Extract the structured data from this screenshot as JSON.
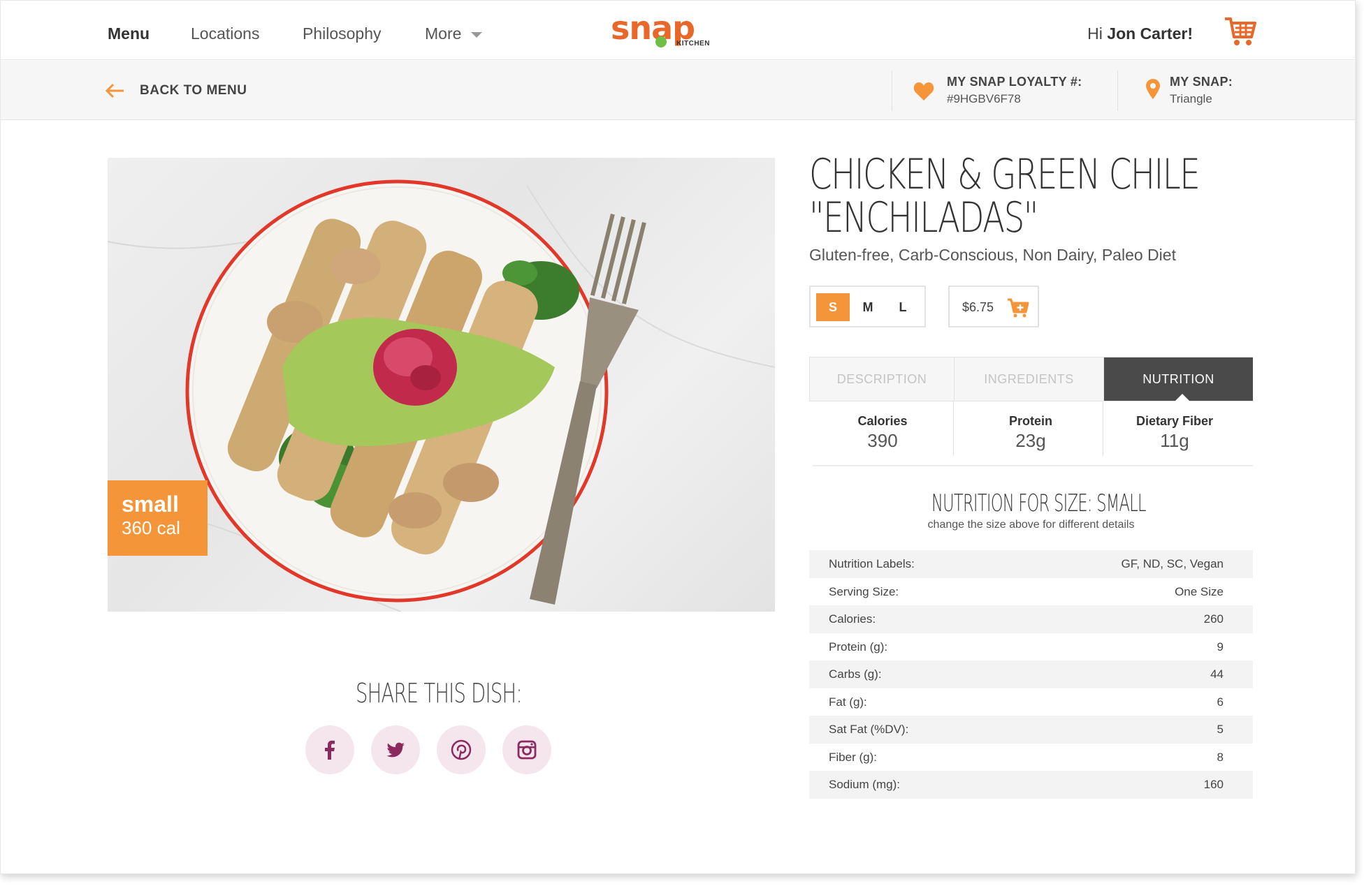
{
  "nav": {
    "links": [
      "Menu",
      "Locations",
      "Philosophy",
      "More"
    ],
    "logo_text": "snap",
    "logo_sub": "KITCHEN",
    "greeting_prefix": "Hi",
    "greeting_name": "Jon Carter!"
  },
  "subbar": {
    "back_label": "BACK TO MENU",
    "loyalty_label": "MY SNAP LOYALTY #:",
    "loyalty_value": "#9HGBV6F78",
    "snap_label": "MY SNAP:",
    "snap_value": "Triangle"
  },
  "hero": {
    "badge_size": "small",
    "badge_cal": "360 cal"
  },
  "share": {
    "title": "SHARE THIS DISH:",
    "networks": [
      "facebook-icon",
      "twitter-icon",
      "pinterest-icon",
      "instagram-icon"
    ]
  },
  "dish": {
    "title_line1": "CHICKEN & GREEN CHILE",
    "title_line2": "\"ENCHILADAS\"",
    "diets": "Gluten-free, Carb-Conscious, Non Dairy, Paleo Diet",
    "sizes": [
      "S",
      "M",
      "L"
    ],
    "selected_size": "S",
    "price": "$6.75"
  },
  "tabs": [
    "DESCRIPTION",
    "INGREDIENTS",
    "NUTRITION"
  ],
  "selected_tab": "NUTRITION",
  "stats": [
    {
      "label": "Calories",
      "value": "390"
    },
    {
      "label": "Protein",
      "value": "23g"
    },
    {
      "label": "Dietary Fiber",
      "value": "11g"
    }
  ],
  "nutrition": {
    "title": "NUTRITION FOR SIZE: SMALL",
    "subtitle": "change the size above for different details",
    "rows": [
      {
        "label": "Nutrition Labels:",
        "value": "GF, ND, SC, Vegan"
      },
      {
        "label": "Serving Size:",
        "value": "One Size"
      },
      {
        "label": "Calories:",
        "value": "260"
      },
      {
        "label": "Protein (g):",
        "value": "9"
      },
      {
        "label": "Carbs (g):",
        "value": "44"
      },
      {
        "label": "Fat (g):",
        "value": "6"
      },
      {
        "label": "Sat Fat (%DV):",
        "value": "5"
      },
      {
        "label": "Fiber (g):",
        "value": "8"
      },
      {
        "label": "Sodium (mg):",
        "value": "160"
      }
    ]
  },
  "colors": {
    "accent": "#f4953a",
    "brand": "#e8682a",
    "dark_tab": "#4a4a4a",
    "social_bg": "#f5e6ee",
    "social_fg": "#8a2a5e"
  }
}
